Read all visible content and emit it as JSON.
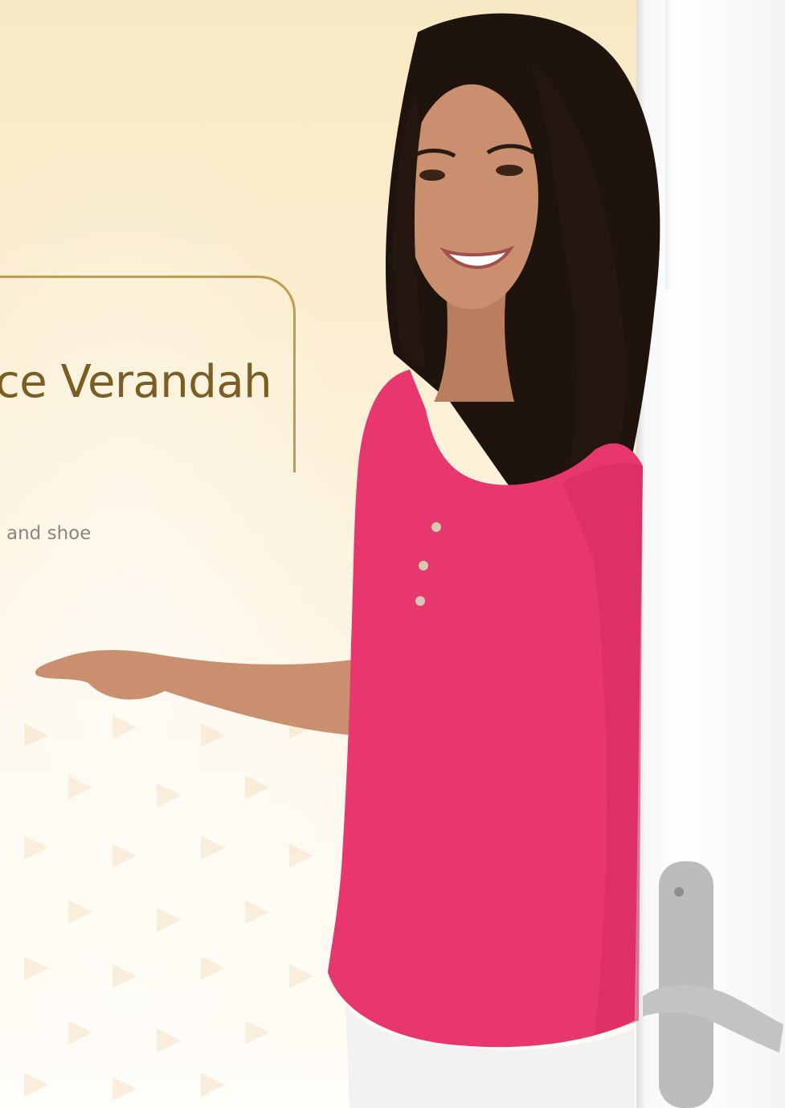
{
  "banner": {
    "headline": "ce Verandah",
    "subtext": "and shoe"
  },
  "photo": {
    "subject": "woman-opening-door",
    "colors": {
      "background": "#f8e9c4",
      "accent_gold": "#c29b52",
      "headline_color": "#7c5d24",
      "shirt_pink": "#e8376f",
      "hair": "#1f130d",
      "skin": "#c98f6e"
    }
  }
}
